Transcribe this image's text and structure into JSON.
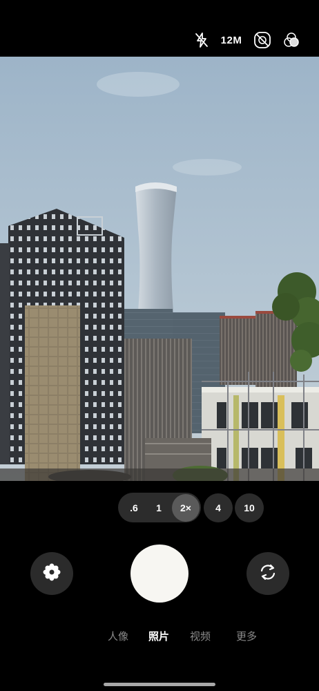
{
  "status_bar": {
    "icons": [
      "flash-off-icon",
      "live-photo-off-icon",
      "filter-icon"
    ],
    "resolution_label": "12M"
  },
  "viewfinder": {
    "scene": "city-skyline-photo-preview"
  },
  "zoom": {
    "options": [
      ".6",
      "1",
      "2×",
      "4",
      "10"
    ],
    "selected": "2×"
  },
  "controls": {
    "left_icon": "flower-icon",
    "shutter_icon": "shutter-button",
    "right_icon": "switch-camera-icon"
  },
  "modes": {
    "items": [
      "人像",
      "照片",
      "视频",
      "更多"
    ],
    "selected": "照片"
  },
  "colors": {
    "background": "#000000",
    "control_bg": "#2b2b2b",
    "zoom_active_bg": "#5a5a5a",
    "shutter": "#f7f6f2",
    "mode_inactive": "#8a8a8a"
  }
}
